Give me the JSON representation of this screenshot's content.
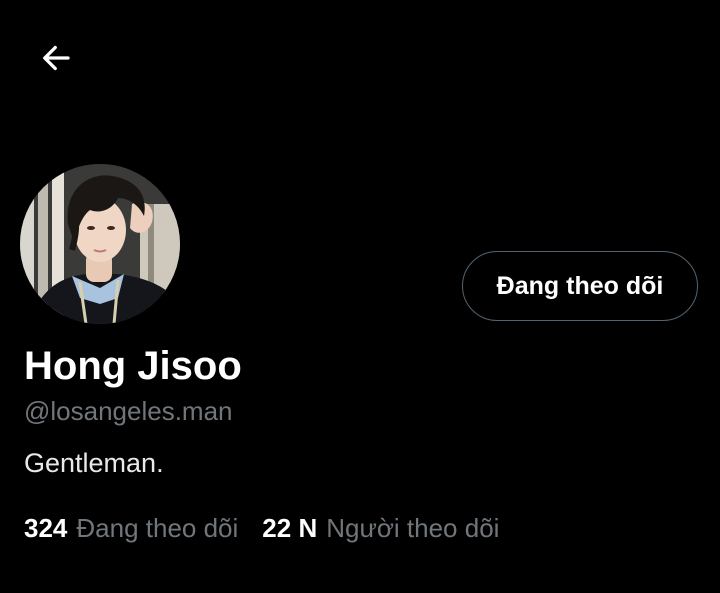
{
  "header": {
    "back_icon": "arrow-left-icon"
  },
  "profile": {
    "display_name": "Hong Jisoo",
    "handle": "@losangeles.man",
    "bio": "Gentleman.",
    "avatar": "profile-photo"
  },
  "actions": {
    "follow_button_label": "Đang theo dõi"
  },
  "stats": {
    "following_count": "324",
    "following_label": "Đang theo dõi",
    "followers_count": "22 N",
    "followers_label": "Người theo dõi"
  },
  "colors": {
    "background": "#000000",
    "primary_text": "#ffffff",
    "secondary_text": "#71767b",
    "button_border": "#536471"
  }
}
